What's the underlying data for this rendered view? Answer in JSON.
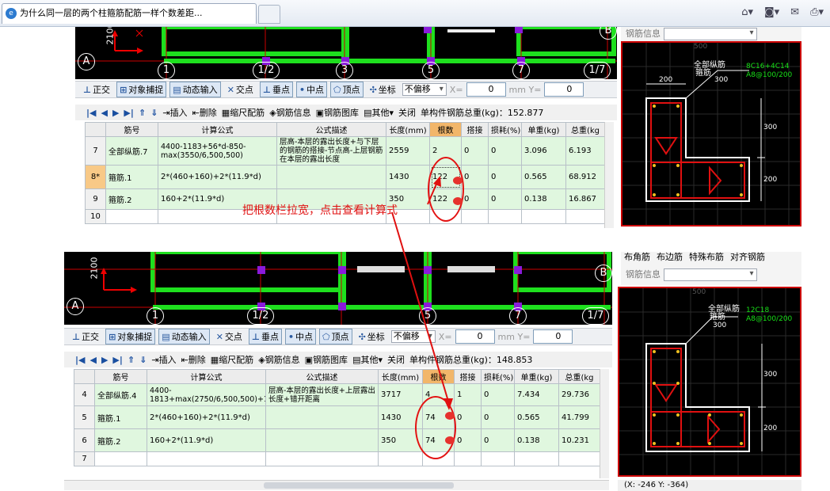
{
  "browser": {
    "tab_title": "为什么同一层的两个柱箍筋配筋一样个数差距...",
    "tools": [
      "home-icon",
      "rss-icon",
      "mail-icon",
      "print-icon"
    ]
  },
  "annotation": "把根数栏拉宽，点击查看计算式",
  "cad": {
    "axis_labels": [
      "1",
      "1/2",
      "3",
      "5",
      "7",
      "1/7"
    ],
    "row_label": "A",
    "row_label_b": "B",
    "dim_label": "2100"
  },
  "toolbar": {
    "ortho": "正交",
    "snap": "对象捕捉",
    "dynamic": "动态输入",
    "intersect": "交点",
    "perp": "垂点",
    "mid": "中点",
    "vertex": "顶点",
    "coord": "坐标",
    "offset": "不偏移",
    "x_label": "X=",
    "x_value": "0",
    "mm_y_label": "mm Y=",
    "y_value": "0"
  },
  "nav": {
    "insert": "插入",
    "delete": "删除",
    "scale": "缩尺配筋",
    "info": "钢筋信息",
    "library": "钢筋图库",
    "other": "其他",
    "close": "关闭",
    "top_weight": "单构件钢筋总重(kg)：152.877",
    "bottom_weight": "单构件钢筋总重(kg)：148.853"
  },
  "columns": [
    "筋号",
    "计算公式",
    "公式描述",
    "长度(mm)",
    "根数",
    "搭接",
    "损耗(%)",
    "单重(kg)",
    "总重(kg"
  ],
  "top_rows": [
    {
      "idx": "7",
      "name": "全部纵筋.7",
      "formula": "4400-1183+56*d-850-max(3550/6,500,500)",
      "desc": "层高-本层的露出长度+与下层的钢筋的搭接-节点高-上层钢筋在本层的露出长度",
      "len": "2559",
      "count": "2",
      "lap": "0",
      "loss": "0",
      "unit": "3.096",
      "total": "6.193"
    },
    {
      "idx": "8*",
      "name": "箍筋.1",
      "formula": "2*(460+160)+2*(11.9*d)",
      "desc": "",
      "len": "1430",
      "count": "122",
      "lap": "0",
      "loss": "0",
      "unit": "0.565",
      "total": "68.912"
    },
    {
      "idx": "9",
      "name": "箍筋.2",
      "formula": "160+2*(11.9*d)",
      "desc": "",
      "len": "350",
      "count": "122",
      "lap": "0",
      "loss": "0",
      "unit": "0.138",
      "total": "16.867"
    },
    {
      "idx": "10",
      "name": "",
      "formula": "",
      "desc": "",
      "len": "",
      "count": "",
      "lap": "",
      "loss": "",
      "unit": "",
      "total": ""
    }
  ],
  "bottom_rows": [
    {
      "idx": "4",
      "name": "全部纵筋.4",
      "formula": "4400-1813+max(2750/6,500,500)+1*max(35*d,500)",
      "desc": "层高-本层的露出长度+上层露出长度+错开距离",
      "len": "3717",
      "count": "4",
      "lap": "1",
      "loss": "0",
      "unit": "7.434",
      "total": "29.736"
    },
    {
      "idx": "5",
      "name": "箍筋.1",
      "formula": "2*(460+160)+2*(11.9*d)",
      "desc": "",
      "len": "1430",
      "count": "74",
      "lap": "0",
      "loss": "0",
      "unit": "0.565",
      "total": "41.799"
    },
    {
      "idx": "6",
      "name": "箍筋.2",
      "formula": "160+2*(11.9*d)",
      "desc": "",
      "len": "350",
      "count": "74",
      "lap": "0",
      "loss": "0",
      "unit": "0.138",
      "total": "10.231"
    },
    {
      "idx": "7",
      "name": "",
      "formula": "",
      "desc": "",
      "len": "",
      "count": "",
      "lap": "",
      "loss": "",
      "unit": "",
      "total": ""
    }
  ],
  "side_top": {
    "info_label": "钢筋信息",
    "title": "全部纵筋",
    "subtitle": "箍筋",
    "spec1": "8C16+4C14",
    "spec2": "A8@100/200",
    "dim_top": "200",
    "dim_mid": "300",
    "dim_right_top": "300",
    "dim_right_bottom": "200",
    "dim_faint": "500"
  },
  "side_bottom": {
    "tabs": [
      "布角筋",
      "布边筋",
      "特殊布筋",
      "对齐钢筋"
    ],
    "info_label": "钢筋信息",
    "title": "全部纵筋",
    "subtitle": "箍筋",
    "spec1": "12C18",
    "spec2": "A8@100/200",
    "dim_mid": "300",
    "dim_right_top": "300",
    "dim_right_bottom": "200",
    "dim_faint": "500"
  },
  "status": "(X: -246 Y: -364)"
}
